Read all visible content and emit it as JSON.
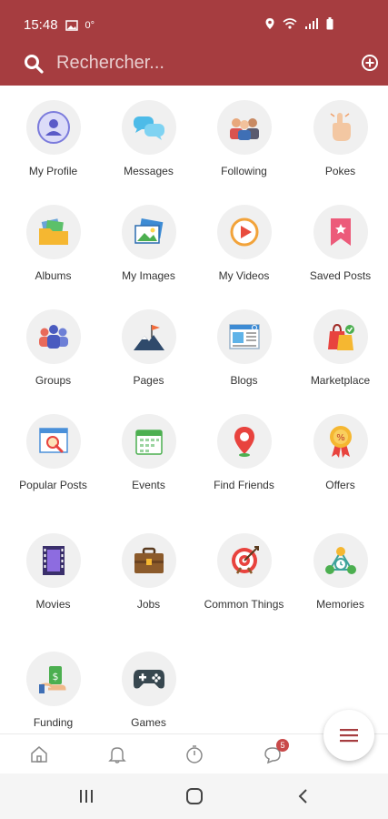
{
  "status_bar": {
    "time": "15:48",
    "temperature": "0°"
  },
  "search": {
    "placeholder": "Rechercher..."
  },
  "menu_items": [
    {
      "label": "My Profile",
      "icon": "profile-icon"
    },
    {
      "label": "Messages",
      "icon": "messages-icon"
    },
    {
      "label": "Following",
      "icon": "following-icon"
    },
    {
      "label": "Pokes",
      "icon": "pokes-icon"
    },
    {
      "label": "Albums",
      "icon": "albums-icon"
    },
    {
      "label": "My Images",
      "icon": "images-icon"
    },
    {
      "label": "My Videos",
      "icon": "videos-icon"
    },
    {
      "label": "Saved Posts",
      "icon": "saved-posts-icon"
    },
    {
      "label": "Groups",
      "icon": "groups-icon"
    },
    {
      "label": "Pages",
      "icon": "pages-icon"
    },
    {
      "label": "Blogs",
      "icon": "blogs-icon"
    },
    {
      "label": "Marketplace",
      "icon": "marketplace-icon"
    },
    {
      "label": "Popular Posts",
      "icon": "popular-posts-icon"
    },
    {
      "label": "Events",
      "icon": "events-icon"
    },
    {
      "label": "Find Friends",
      "icon": "find-friends-icon"
    },
    {
      "label": "Offers",
      "icon": "offers-icon"
    },
    {
      "label": "Movies",
      "icon": "movies-icon"
    },
    {
      "label": "Jobs",
      "icon": "jobs-icon"
    },
    {
      "label": "Common Things",
      "icon": "common-things-icon"
    },
    {
      "label": "Memories",
      "icon": "memories-icon"
    },
    {
      "label": "Funding",
      "icon": "funding-icon"
    },
    {
      "label": "Games",
      "icon": "games-icon"
    }
  ],
  "bottom_nav": {
    "messages_badge": "5"
  },
  "colors": {
    "header": "#a63d40",
    "accent": "#c94a4a"
  }
}
